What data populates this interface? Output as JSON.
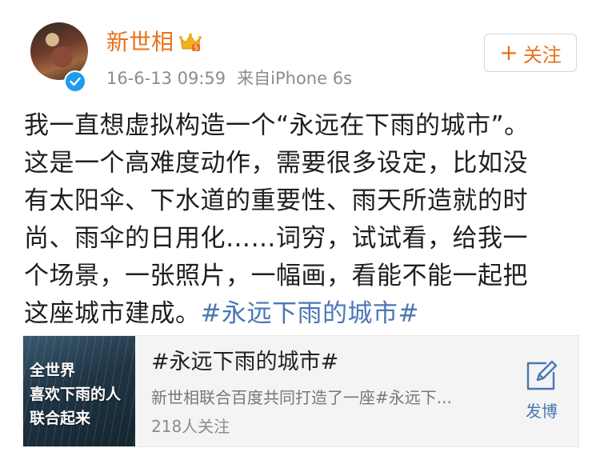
{
  "post": {
    "author": "新世相",
    "date": "16-6-13 09:59",
    "source": "来自iPhone 6s",
    "follow_label": "关注",
    "text_lines": [
      "我一直想虚拟构造一个“永远在下雨的城市”。",
      "这是一个高难度动作，需要很多设定，比如没",
      "有太阳伞、下水道的重要性、雨天所造就的时",
      "尚、雨伞的日用化……词穷，试试看，给我一",
      "个场景，一张照片，一幅画，看能不能一起把"
    ],
    "last_line_prefix": "这座城市建成。",
    "hashtag": "#永远下雨的城市#"
  },
  "card": {
    "thumb_lines": [
      "全世界",
      "喜欢下雨的人",
      "联合起来"
    ],
    "title": "#永远下雨的城市#",
    "description": "新世相联合百度共同打造了一座#永远下...",
    "followers": "218人关注",
    "publish_label": "发博"
  },
  "colors": {
    "username": "#e8711a",
    "hashtag": "#4a77b4",
    "verified": "#1f9bf0"
  }
}
